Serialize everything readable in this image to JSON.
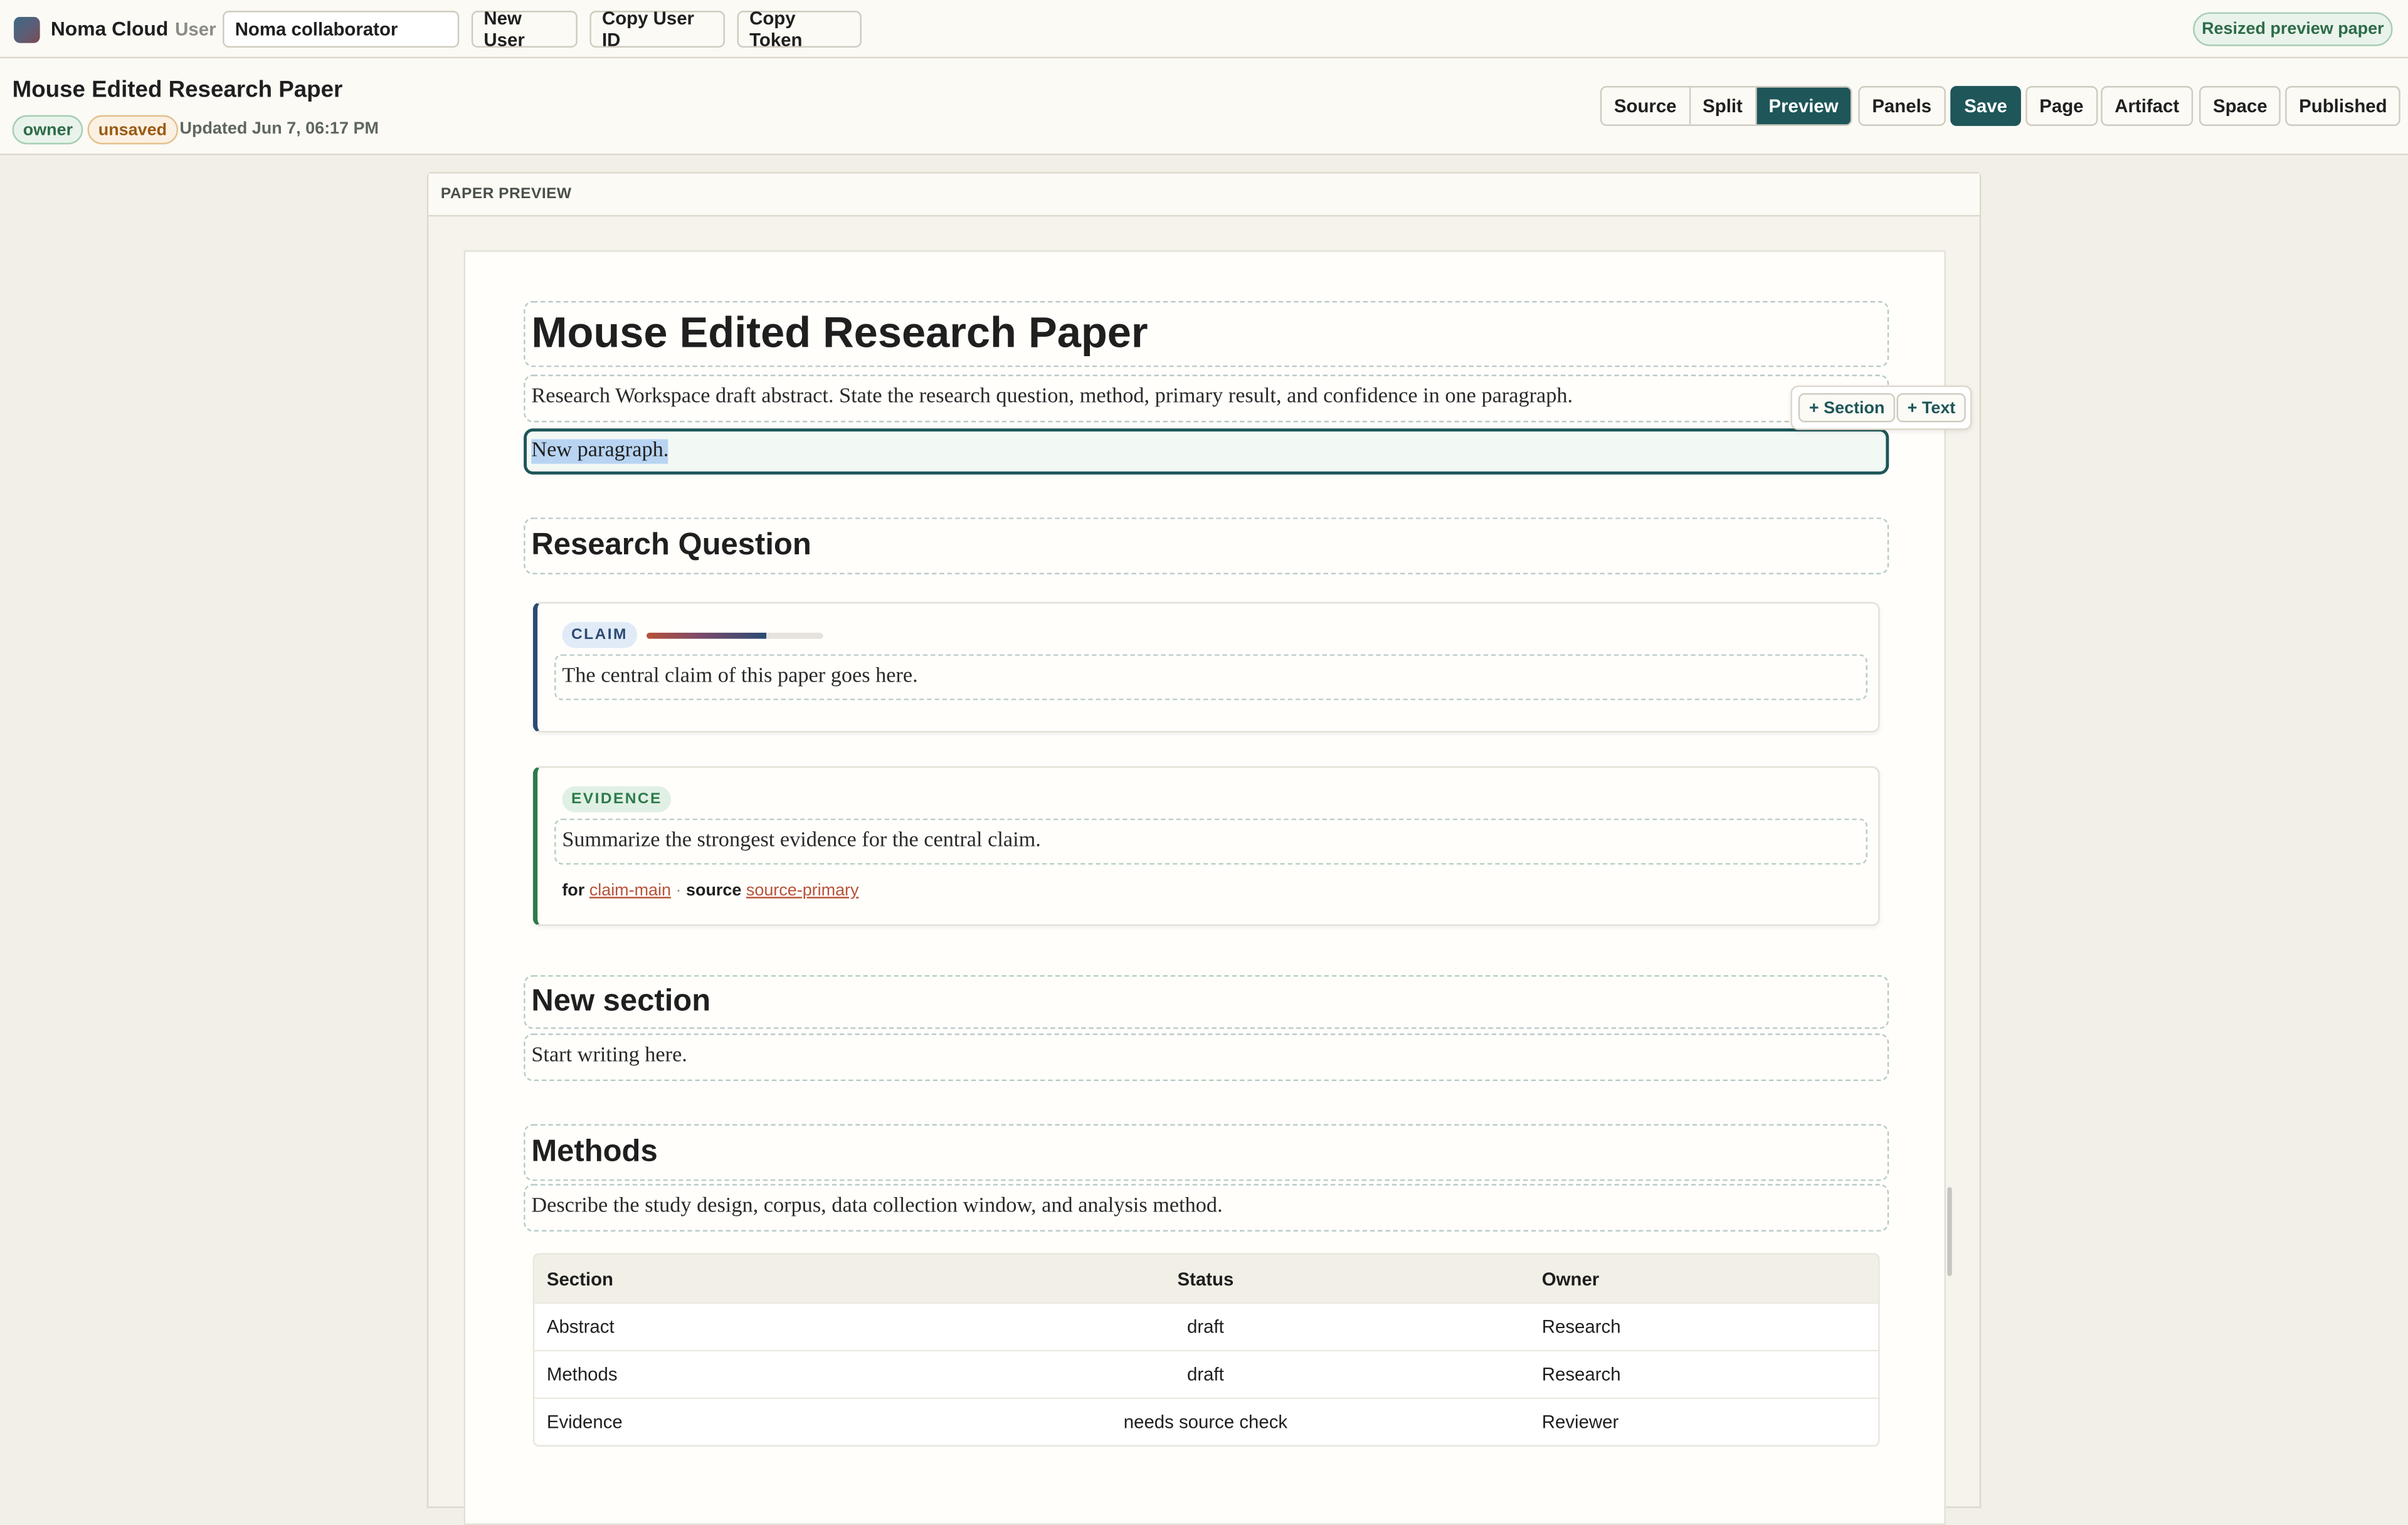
{
  "app": {
    "name": "Noma Cloud",
    "user_label": "User",
    "user_value": "Noma collaborator"
  },
  "toolbar": {
    "new_user": "New User",
    "copy_user_id": "Copy User ID",
    "copy_token": "Copy Token",
    "status_pill": "Resized preview paper"
  },
  "document": {
    "title": "Mouse Edited Research Paper",
    "badges": {
      "owner": "owner",
      "unsaved": "unsaved"
    },
    "updated": "Updated Jun 7, 06:17 PM"
  },
  "view_modes": {
    "source": "Source",
    "split": "Split",
    "preview": "Preview",
    "active": "Preview"
  },
  "actions": {
    "panels": "Panels",
    "save": "Save",
    "page": "Page",
    "artifact": "Artifact",
    "space": "Space",
    "published": "Published"
  },
  "preview": {
    "heading": "PAPER PREVIEW",
    "paper_title": "Mouse Edited Research Paper",
    "abstract": "Research Workspace draft abstract. State the research question, method, primary result, and confidence in one paragraph.",
    "new_paragraph": "New paragraph.",
    "insert_menu": {
      "section": "+ Section",
      "text": "+ Text"
    },
    "research_question": "Research Question",
    "claim": {
      "label": "CLAIM",
      "text": "The central claim of this paper goes here.",
      "confidence": 0.68
    },
    "evidence": {
      "label": "EVIDENCE",
      "text": "Summarize the strongest evidence for the central claim.",
      "for_label": "for",
      "for_link": "claim-main",
      "separator": "·",
      "source_label": "source",
      "source_link": "source-primary"
    },
    "new_section": "New section",
    "start_writing": "Start writing here.",
    "methods": "Methods",
    "methods_text": "Describe the study design, corpus, data collection window, and analysis method.",
    "table": {
      "headers": [
        "Section",
        "Status",
        "Owner"
      ],
      "rows": [
        [
          "Abstract",
          "draft",
          "Research"
        ],
        [
          "Methods",
          "draft",
          "Research"
        ],
        [
          "Evidence",
          "needs source check",
          "Reviewer"
        ]
      ]
    }
  },
  "colors": {
    "accent": "#1e5659",
    "claim": "#2b4a74",
    "evidence": "#2d7a4a",
    "link": "#b8523a"
  }
}
